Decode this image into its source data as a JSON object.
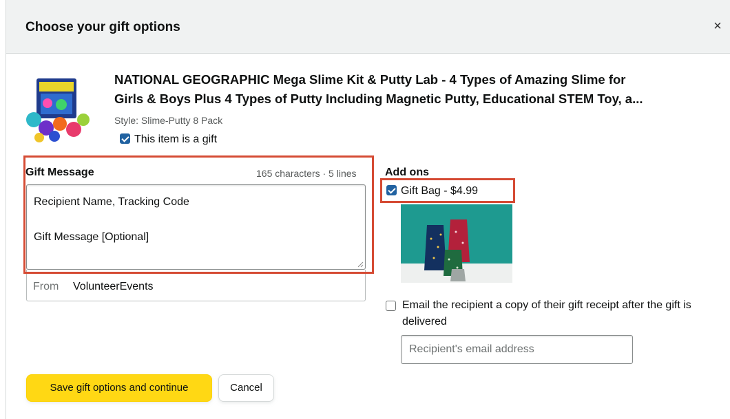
{
  "dialog": {
    "title": "Choose your gift options",
    "close_glyph": "×"
  },
  "product": {
    "title_line1": "NATIONAL GEOGRAPHIC Mega Slime Kit & Putty Lab - 4 Types of Amazing Slime for",
    "title_line2": "Girls & Boys Plus 4 Types of Putty Including Magnetic Putty, Educational STEM Toy, a...",
    "style": "Style: Slime-Putty 8 Pack",
    "is_gift_label": "This item is a gift",
    "is_gift_checked": true
  },
  "gift_message": {
    "label": "Gift Message",
    "counter": "165 characters · 5 lines",
    "line1": "Recipient Name, Tracking Code",
    "line2": "Gift Message [Optional]",
    "from_label": "From",
    "from_value": "VolunteerEvents"
  },
  "addons": {
    "label": "Add ons",
    "gift_bag_label": "Gift Bag - $4.99",
    "gift_bag_checked": true,
    "email_receipt_label": "Email the recipient a copy of their gift receipt after the gift is delivered",
    "email_receipt_checked": false,
    "email_placeholder": "Recipient's email address"
  },
  "actions": {
    "save_label": "Save gift options and continue",
    "cancel_label": "Cancel"
  },
  "colors": {
    "header_bg": "#f0f2f2",
    "checkbox": "#2162a1",
    "primary_button": "#ffd814",
    "highlight": "#d54b34"
  }
}
